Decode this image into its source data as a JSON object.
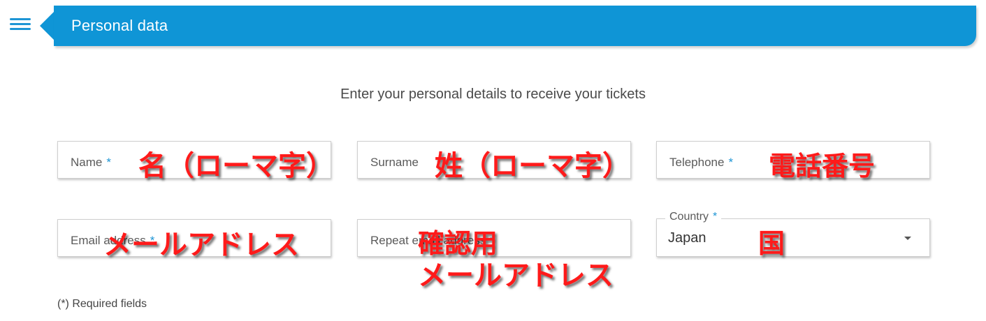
{
  "header": {
    "title": "Personal data"
  },
  "intro": "Enter your personal details to receive your tickets",
  "fields": {
    "name": {
      "label": "Name",
      "required_mark": "*",
      "annotation": "名（ローマ字）"
    },
    "surname": {
      "label": "Surname",
      "required_mark": "",
      "annotation": "姓（ローマ字）"
    },
    "telephone": {
      "label": "Telephone",
      "required_mark": "*",
      "annotation": "電話番号"
    },
    "email": {
      "label": "Email address",
      "required_mark": "*",
      "annotation": "メールアドレス"
    },
    "repeat_email": {
      "label": "Repeat email address",
      "required_mark": "*",
      "annotation_line1": "確認用",
      "annotation_line2": "メールアドレス"
    },
    "country": {
      "label": "Country",
      "required_mark": "*",
      "value": "Japan",
      "annotation": "国"
    }
  },
  "required_note": "(*) Required fields",
  "colors": {
    "accent": "#0f95d6",
    "annotation": "#ff1a1a"
  },
  "icons": {
    "menu": "hamburger-menu-icon",
    "dropdown": "caret-down-icon"
  }
}
